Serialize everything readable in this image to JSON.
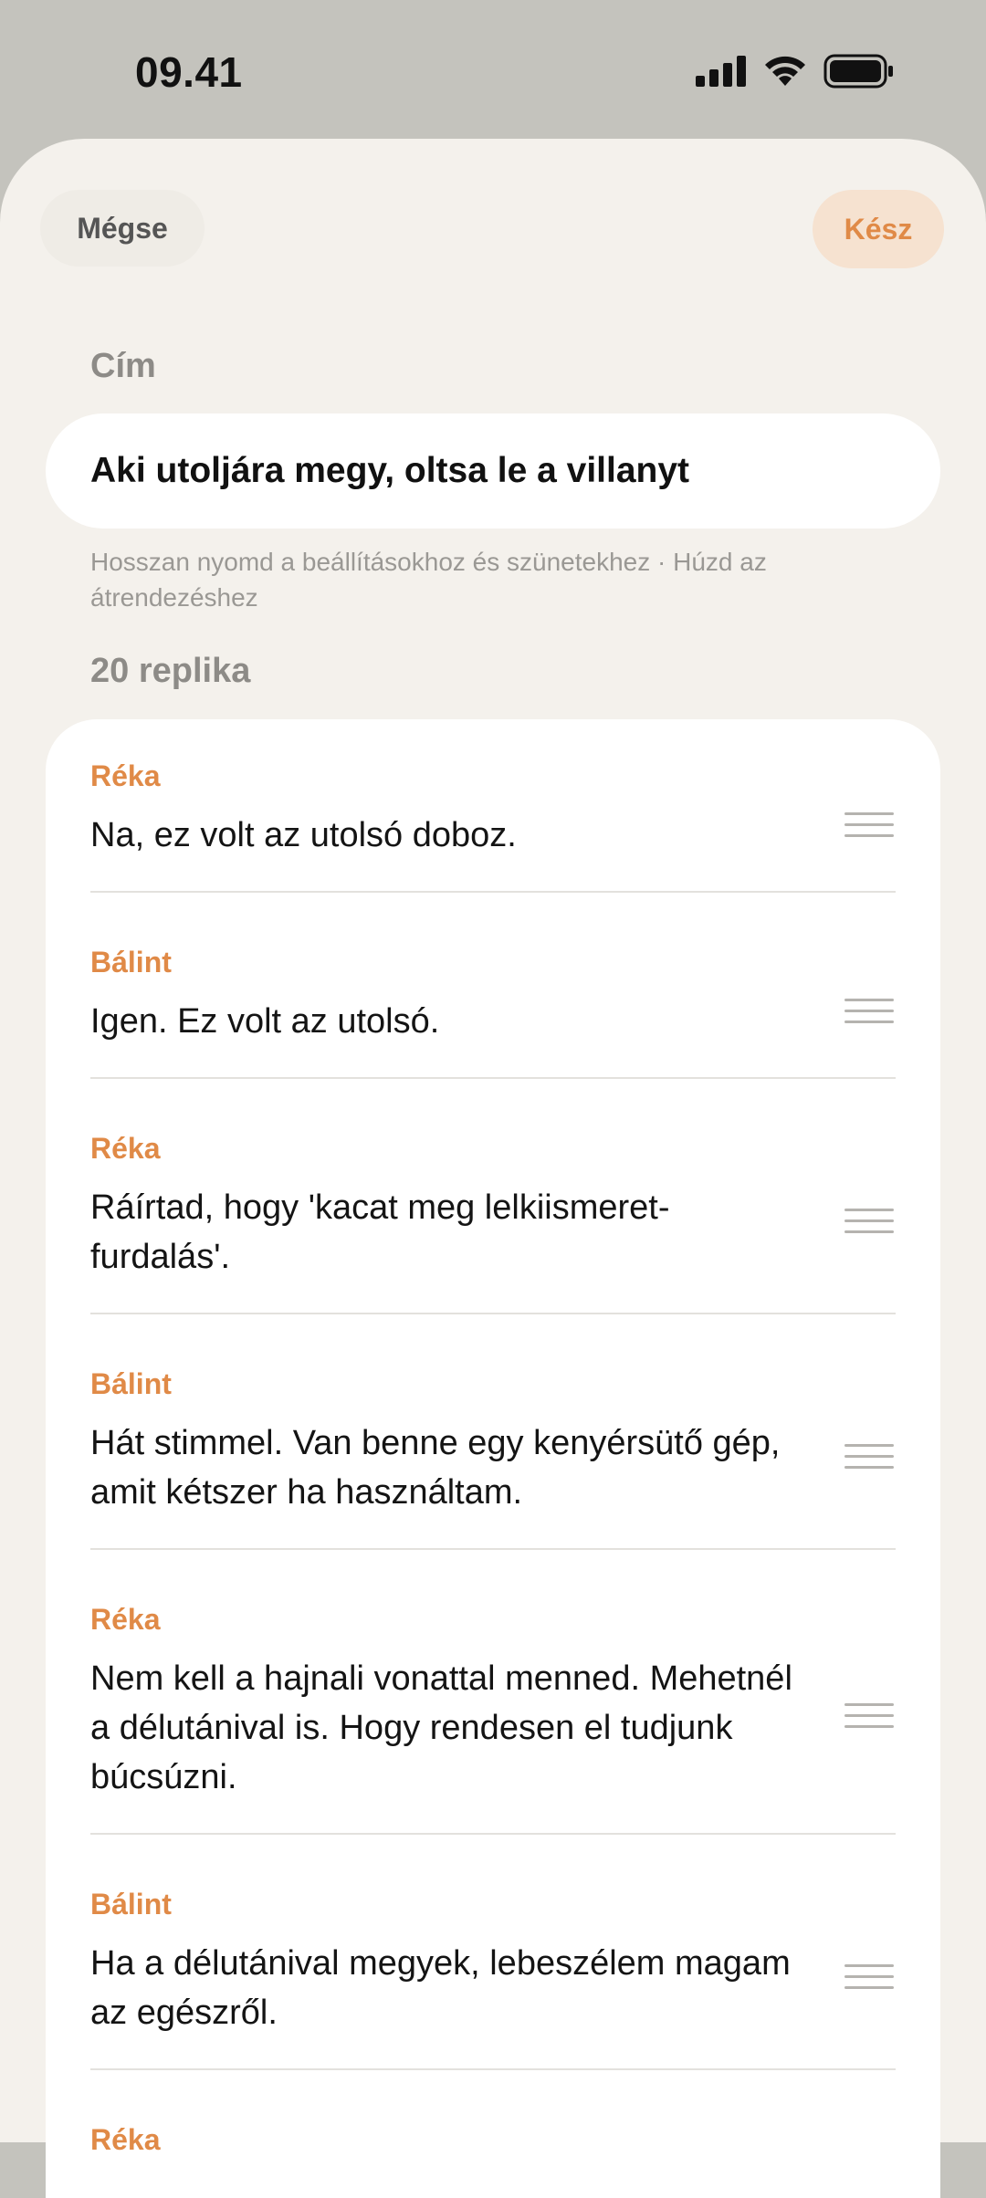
{
  "status": {
    "time": "09.41"
  },
  "header": {
    "cancel_label": "Mégse",
    "done_label": "Kész"
  },
  "title_section": {
    "label": "Cím",
    "value": "Aki utoljára megy, oltsa le a villanyt",
    "hint": "Hosszan nyomd a beállításokhoz és szünetekhez · Húzd az átrendezéshez"
  },
  "lines_section": {
    "count_label": "20 replika",
    "items": [
      {
        "speaker": "Réka",
        "text": "Na, ez volt az utolsó doboz."
      },
      {
        "speaker": "Bálint",
        "text": "Igen. Ez volt az utolsó."
      },
      {
        "speaker": "Réka",
        "text": "Ráírtad, hogy 'kacat meg lelkiismeret-furdalás'."
      },
      {
        "speaker": "Bálint",
        "text": "Hát stimmel. Van benne egy kenyérsütő gép, amit kétszer ha használtam."
      },
      {
        "speaker": "Réka",
        "text": "Nem kell a hajnali vonattal menned. Mehetnél a délutánival is. Hogy rendesen el tudjunk búcsúzni."
      },
      {
        "speaker": "Bálint",
        "text": "Ha a délutánival megyek, lebeszélem magam az egészről."
      },
      {
        "speaker": "Réka",
        "text": ""
      }
    ]
  },
  "icons": {
    "signal": "cellular-signal-icon",
    "wifi": "wifi-icon",
    "battery": "battery-icon",
    "drag": "drag-handle-icon"
  },
  "colors": {
    "accent": "#e08a47",
    "sheet_bg": "#f4f1ec",
    "status_bg": "#c4c3bd"
  }
}
